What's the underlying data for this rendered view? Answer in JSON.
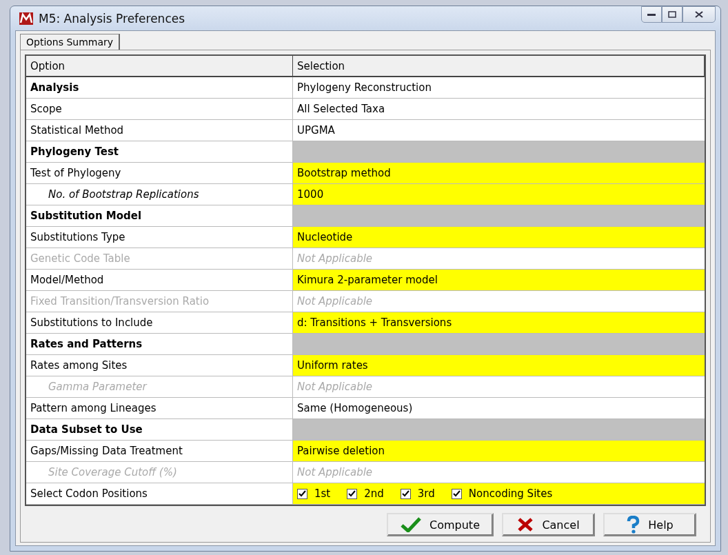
{
  "window": {
    "title": "M5: Analysis Preferences"
  },
  "tabs": [
    {
      "label": "Options Summary",
      "selected": true
    }
  ],
  "table": {
    "columns": [
      "Option",
      "Selection"
    ],
    "rows": [
      {
        "kind": "section",
        "option": "Analysis",
        "selection": "Phylogeny Reconstruction"
      },
      {
        "kind": "option",
        "option": "Scope",
        "selection": "All Selected Taxa",
        "highlighted": false,
        "disabled": false
      },
      {
        "kind": "option",
        "option": "Statistical Method",
        "selection": "UPGMA",
        "highlighted": false,
        "disabled": false
      },
      {
        "kind": "section",
        "option": "Phylogeny Test"
      },
      {
        "kind": "option",
        "option": "Test of Phylogeny",
        "selection": "Bootstrap method",
        "highlighted": true,
        "disabled": false,
        "children": [
          {
            "kind": "option",
            "option": "No. of Bootstrap Replications",
            "selection": "1000",
            "highlighted": true,
            "disabled": false
          }
        ]
      },
      {
        "kind": "section",
        "option": "Substitution Model"
      },
      {
        "kind": "option",
        "option": "Substitutions Type",
        "selection": "Nucleotide",
        "highlighted": true,
        "disabled": false
      },
      {
        "kind": "option",
        "option": "Genetic Code Table",
        "selection": "Not Applicable",
        "highlighted": false,
        "disabled": true
      },
      {
        "kind": "option",
        "option": "Model/Method",
        "selection": "Kimura 2-parameter model",
        "highlighted": true,
        "disabled": false
      },
      {
        "kind": "option",
        "option": "Fixed Transition/Transversion Ratio",
        "selection": "Not Applicable",
        "highlighted": false,
        "disabled": true
      },
      {
        "kind": "option",
        "option": "Substitutions to Include",
        "selection": "d: Transitions + Transversions",
        "highlighted": true,
        "disabled": false
      },
      {
        "kind": "section",
        "option": "Rates and Patterns"
      },
      {
        "kind": "option",
        "option": "Rates among Sites",
        "selection": "Uniform rates",
        "highlighted": true,
        "disabled": false,
        "children": [
          {
            "kind": "option",
            "option": "Gamma Parameter",
            "selection": "Not Applicable",
            "highlighted": false,
            "disabled": true
          }
        ]
      },
      {
        "kind": "option",
        "option": "Pattern among Lineages",
        "selection": "Same (Homogeneous)",
        "highlighted": false,
        "disabled": false
      },
      {
        "kind": "section",
        "option": "Data Subset to Use"
      },
      {
        "kind": "option",
        "option": "Gaps/Missing Data Treatment",
        "selection": "Pairwise deletion",
        "highlighted": true,
        "disabled": false,
        "children": [
          {
            "kind": "option",
            "option": "Site Coverage Cutoff (%)",
            "selection": "Not Applicable",
            "highlighted": false,
            "disabled": true
          }
        ]
      },
      {
        "kind": "checks",
        "option": "Select Codon Positions",
        "highlighted": true,
        "checkboxes": [
          {
            "label": "1st",
            "checked": true
          },
          {
            "label": "2nd",
            "checked": true
          },
          {
            "label": "3rd",
            "checked": true
          },
          {
            "label": "Noncoding Sites",
            "checked": true
          }
        ]
      }
    ]
  },
  "buttons": [
    {
      "kind": "compute",
      "label": "Compute"
    },
    {
      "kind": "cancel",
      "label": "Cancel"
    },
    {
      "kind": "help",
      "label": "Help"
    }
  ]
}
